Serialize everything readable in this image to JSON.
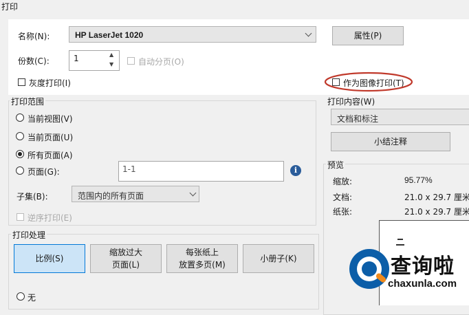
{
  "dialog": {
    "title": "打印"
  },
  "printer": {
    "name_label": "名称(N):",
    "name_value": "HP LaserJet 1020",
    "properties_button": "属性(P)",
    "copies_label": "份数(C):",
    "copies_value": "1",
    "collate_label": "自动分页(O)",
    "grayscale_label": "灰度打印(I)",
    "print_as_image_label": "作为图像打印(T)"
  },
  "print_range": {
    "legend": "打印范围",
    "current_view": "当前视图(V)",
    "current_page": "当前页面(U)",
    "all_pages": "所有页面(A)",
    "pages": "页面(G):",
    "pages_value": "1-1",
    "subset_label": "子集(B):",
    "subset_value": "范围内的所有页面",
    "reverse_label": "逆序打印(E)"
  },
  "print_content": {
    "legend": "打印内容(W)",
    "value": "文档和标注",
    "summary_button": "小结注释"
  },
  "preview": {
    "legend": "预览",
    "zoom_label": "缩放:",
    "zoom_value": "95.77%",
    "document_label": "文档:",
    "document_value": "21.0 x 29.7 厘米",
    "paper_label": "纸张:",
    "paper_value": "21.0 x 29.7 厘米"
  },
  "handling": {
    "legend": "打印处理",
    "scale_button": "比例(S)",
    "shrink_line1": "缩放过大",
    "shrink_line2": "页面(L)",
    "multiple_line1": "每张纸上",
    "multiple_line2": "放置多页(M)",
    "booklet_button": "小册子(K)",
    "none_label": "无"
  },
  "watermark": {
    "cn": "查询啦",
    "en": "chaxunla.com"
  },
  "colors": {
    "accent": "#0c5ea8",
    "highlight_oval": "#c0392b",
    "selected_button": "#cce4f7"
  }
}
